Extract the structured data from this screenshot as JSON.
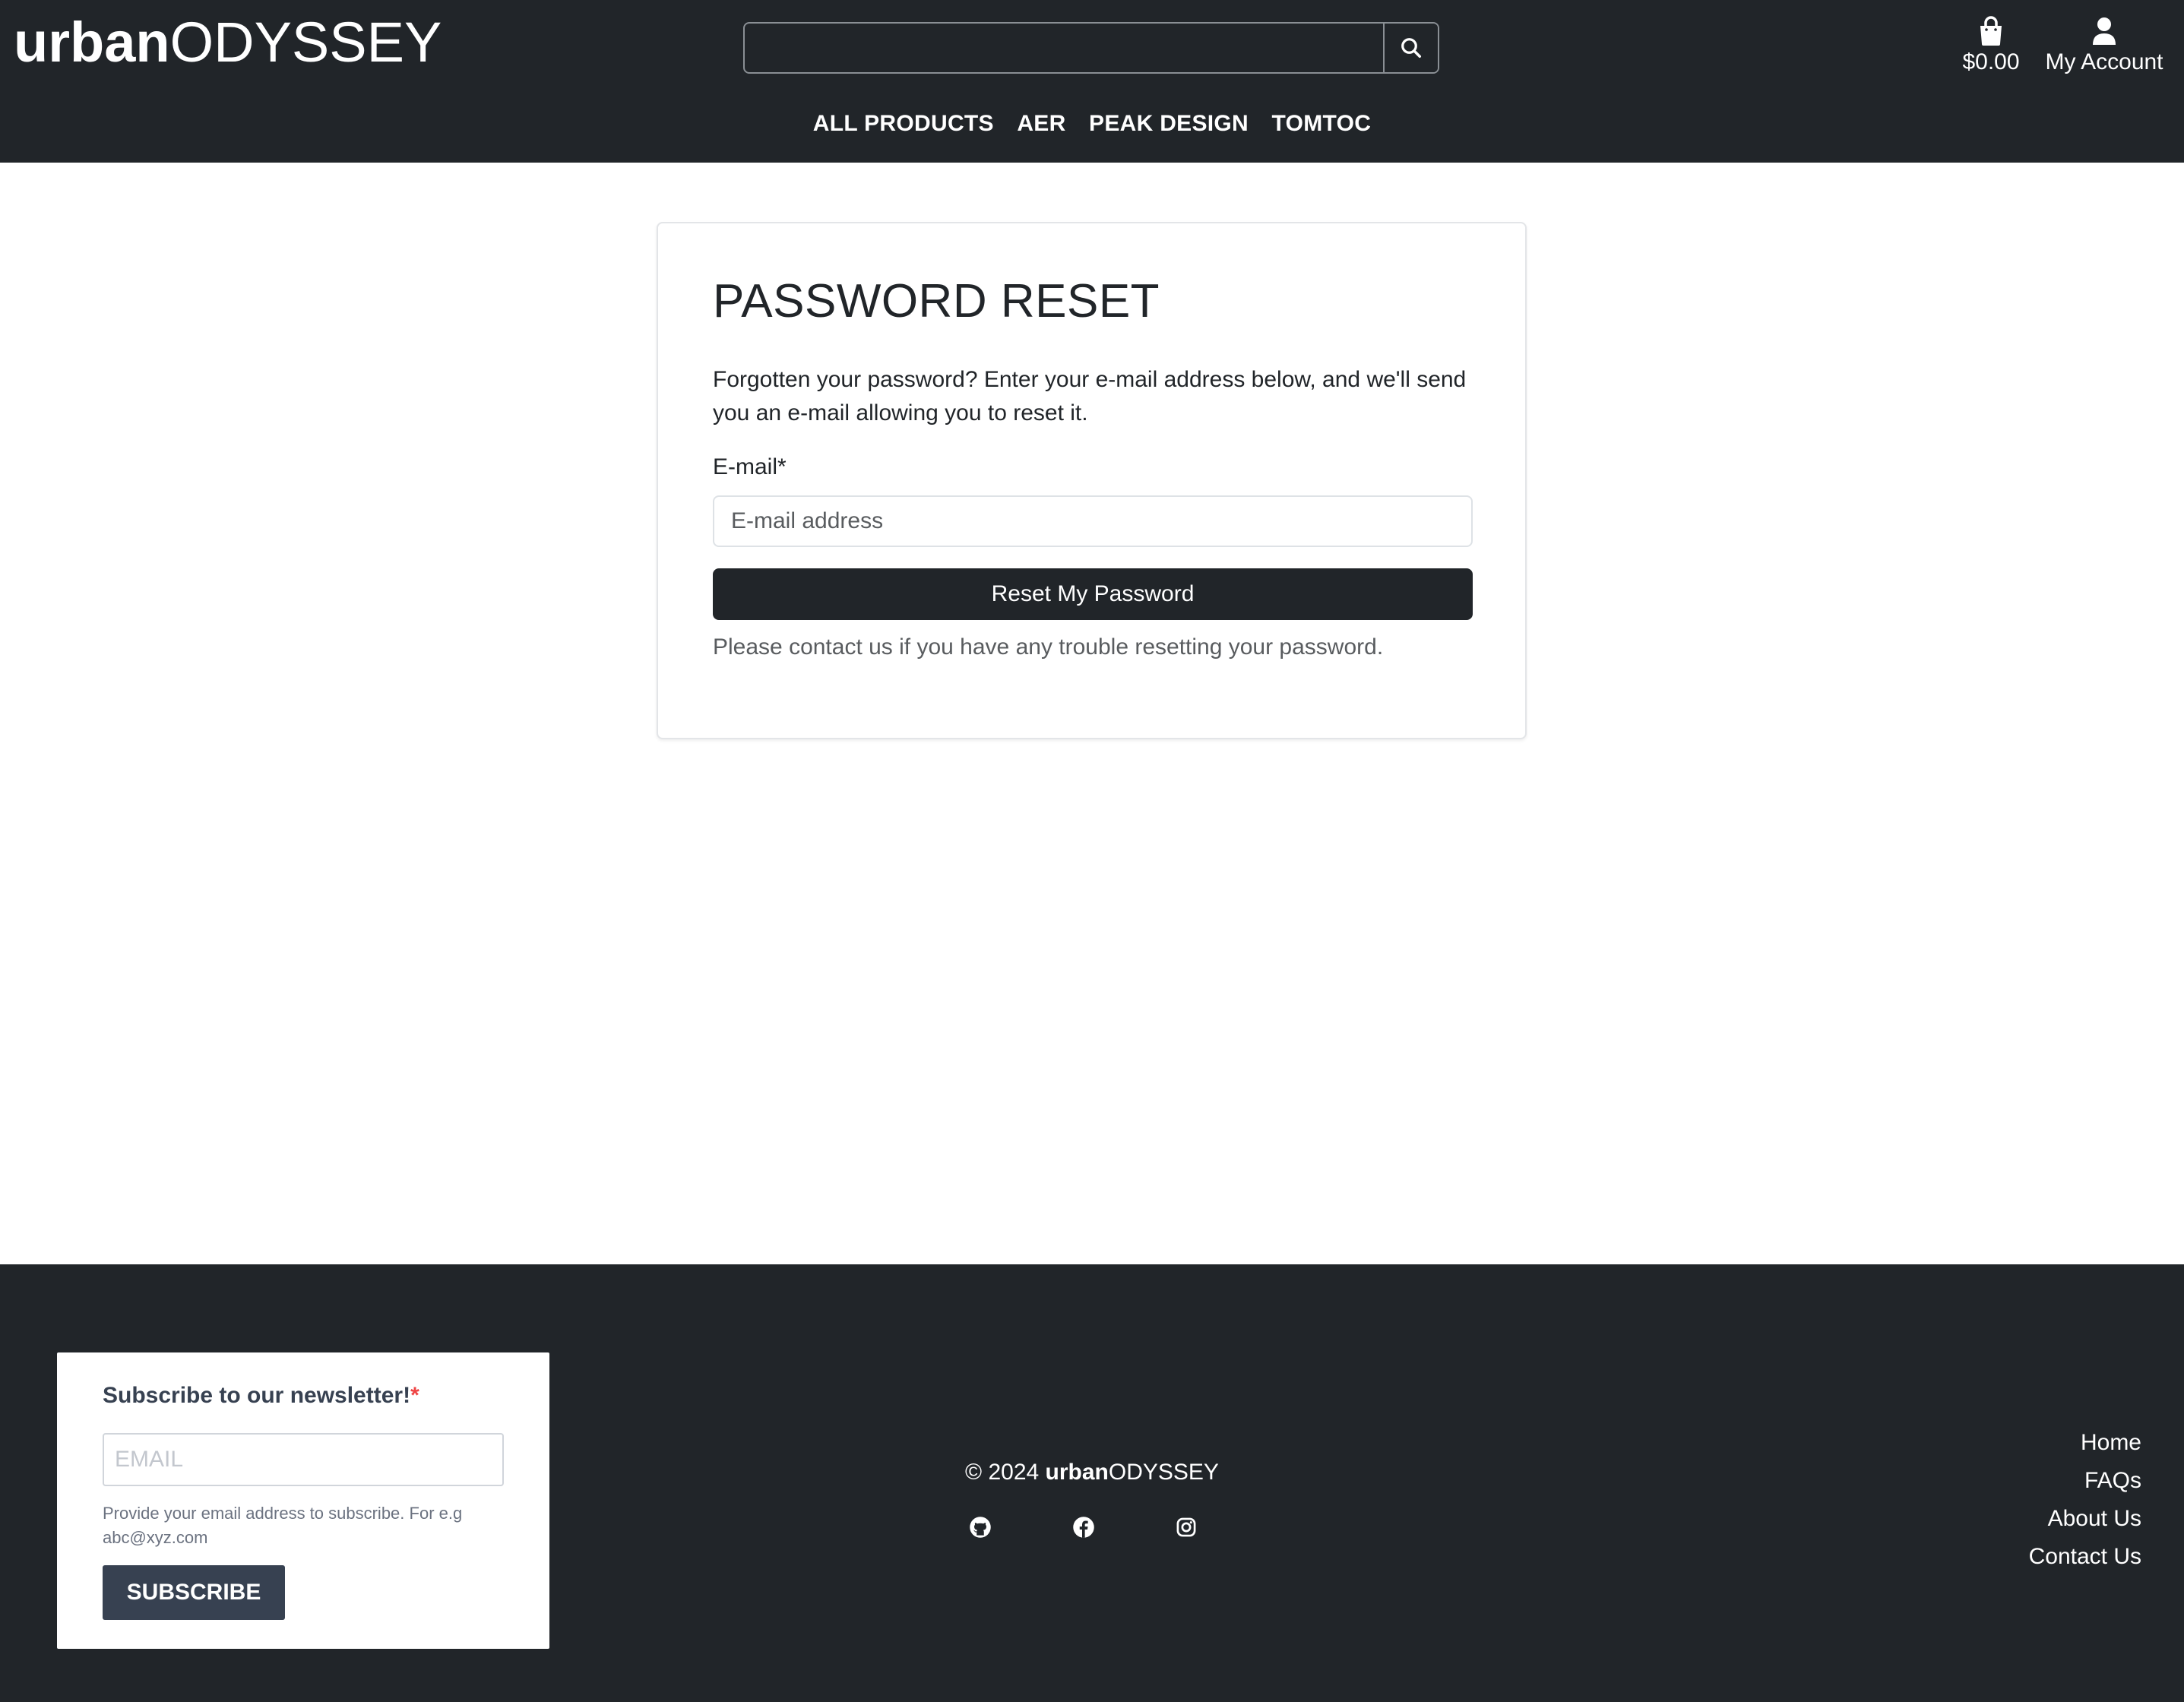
{
  "header": {
    "logo_bold": "urban",
    "logo_rest": "ODYSSEY",
    "search": {
      "placeholder": "",
      "value": ""
    },
    "cart_total": "$0.00",
    "account_label": "My Account",
    "nav": [
      "ALL PRODUCTS",
      "AER",
      "PEAK DESIGN",
      "TOMTOC"
    ]
  },
  "reset": {
    "title": "PASSWORD RESET",
    "intro": "Forgotten your password? Enter your e-mail address below, and we'll send you an e-mail allowing you to reset it.",
    "email_label": "E-mail*",
    "email_placeholder": "E-mail address",
    "button_label": "Reset My Password",
    "contact_note": "Please contact us if you have any trouble resetting your password."
  },
  "footer": {
    "newsletter": {
      "title": "Subscribe to our newsletter!",
      "required_mark": "*",
      "email_placeholder": "EMAIL",
      "help_text": "Provide your email address to subscribe. For e.g abc@xyz.com",
      "button_label": "SUBSCRIBE"
    },
    "copyright_prefix": "© 2024 ",
    "brand_bold": "urban",
    "brand_rest": "ODYSSEY",
    "socials": [
      "github-icon",
      "facebook-icon",
      "instagram-icon"
    ],
    "links": [
      "Home",
      "FAQs",
      "About Us",
      "Contact Us"
    ]
  },
  "colors": {
    "dark": "#212529",
    "newsletter_button": "#374151",
    "required": "#ef4444"
  }
}
